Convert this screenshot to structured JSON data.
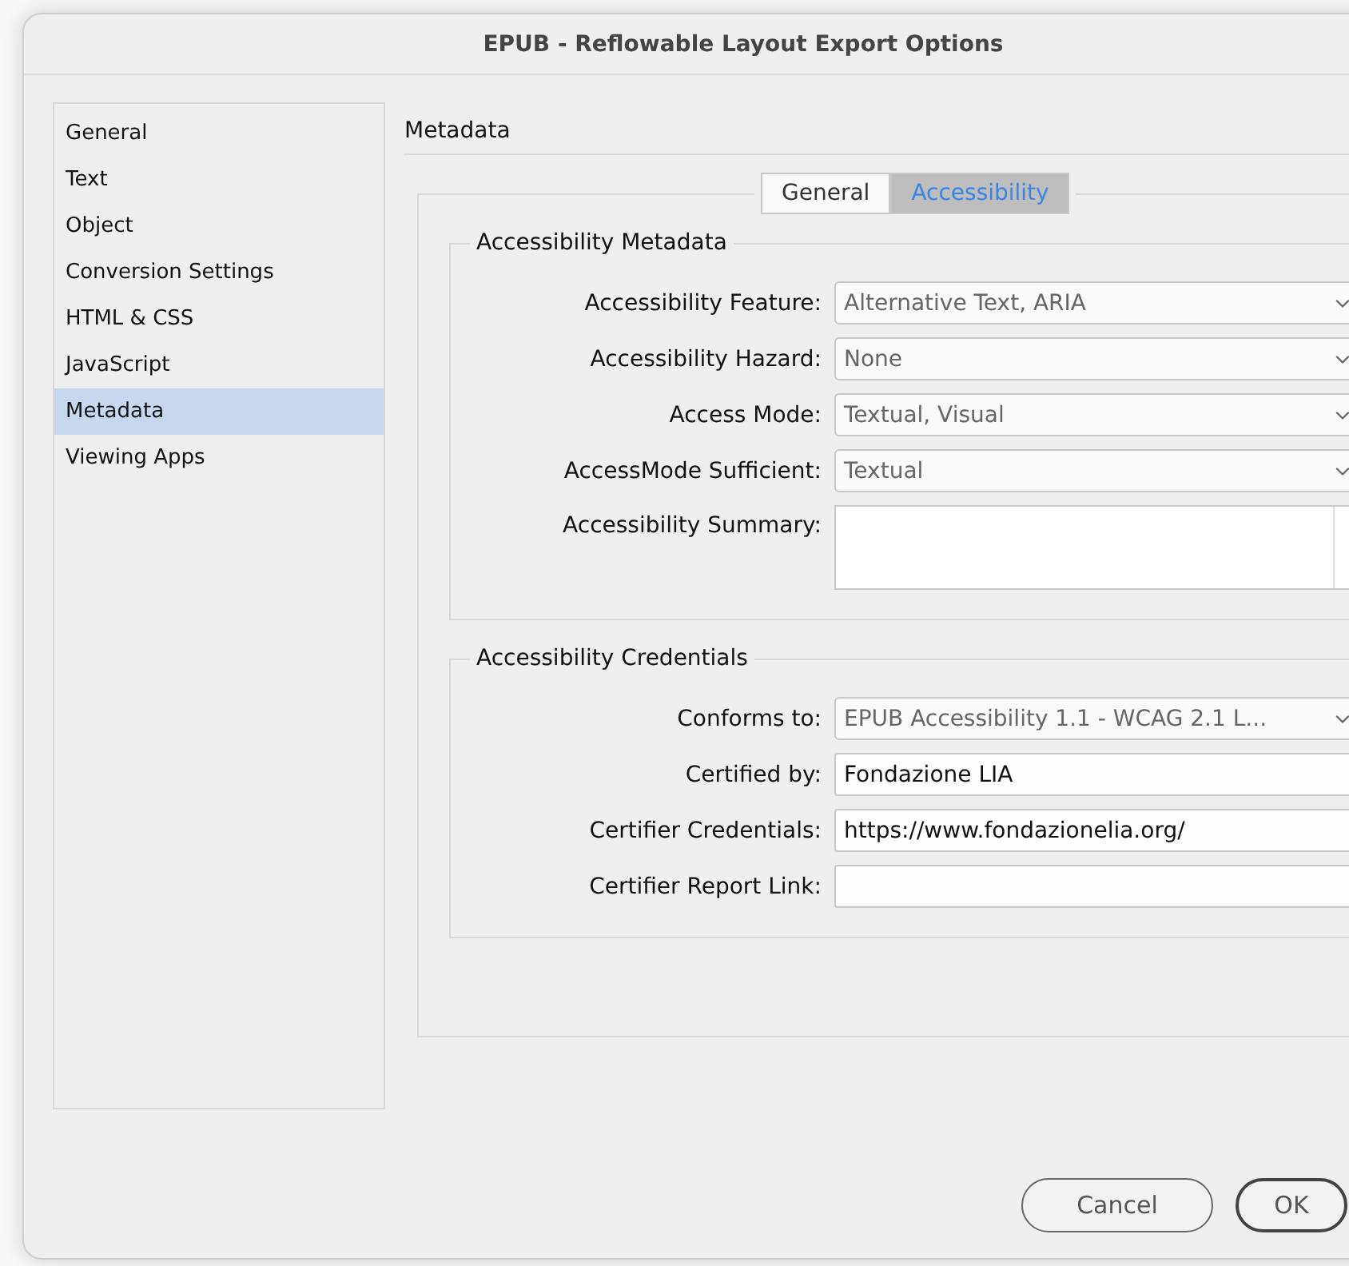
{
  "window": {
    "title": "EPUB - Reflowable Layout Export Options"
  },
  "sidebar": {
    "items": [
      {
        "label": "General",
        "selected": false
      },
      {
        "label": "Text",
        "selected": false
      },
      {
        "label": "Object",
        "selected": false
      },
      {
        "label": "Conversion Settings",
        "selected": false
      },
      {
        "label": "HTML & CSS",
        "selected": false
      },
      {
        "label": "JavaScript",
        "selected": false
      },
      {
        "label": "Metadata",
        "selected": true
      },
      {
        "label": "Viewing Apps",
        "selected": false
      }
    ]
  },
  "panel": {
    "heading": "Metadata",
    "tabs": [
      {
        "label": "General",
        "selected": false
      },
      {
        "label": "Accessibility",
        "selected": true
      }
    ],
    "groups": [
      {
        "legend": "Accessibility Metadata",
        "fields": [
          {
            "kind": "dropdown",
            "label": "Accessibility Feature:",
            "value": "Alternative Text, ARIA"
          },
          {
            "kind": "dropdown",
            "label": "Accessibility Hazard:",
            "value": "None"
          },
          {
            "kind": "dropdown",
            "label": "Access Mode:",
            "value": "Textual, Visual"
          },
          {
            "kind": "dropdown",
            "label": "AccessMode Sufficient:",
            "value": "Textual"
          },
          {
            "kind": "textarea",
            "label": "Accessibility Summary:"
          }
        ]
      },
      {
        "legend": "Accessibility Credentials",
        "fields": [
          {
            "kind": "dropdown",
            "label": "Conforms to:",
            "value": "EPUB Accessibility 1.1 - WCAG 2.1 L..."
          },
          {
            "kind": "text",
            "label": "Certified by:",
            "value": "Fondazione LIA"
          },
          {
            "kind": "text",
            "label": "Certifier Credentials:",
            "value": "https://www.fondazionelia.org/"
          },
          {
            "kind": "text",
            "label": "Certifier Report Link:"
          }
        ]
      }
    ]
  },
  "buttons": [
    {
      "label": "Cancel",
      "kind": "secondary"
    },
    {
      "label": "OK",
      "kind": "default"
    }
  ]
}
